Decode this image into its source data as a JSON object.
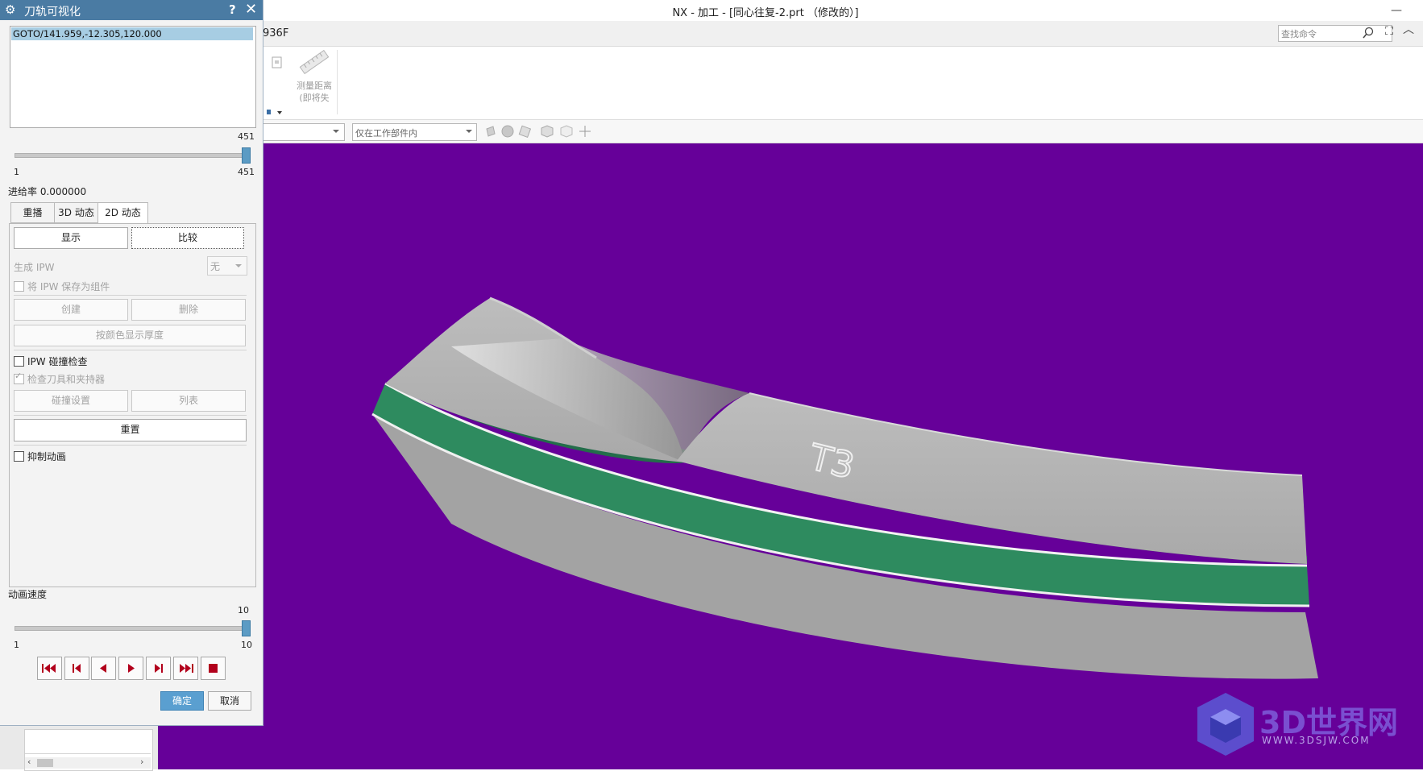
{
  "window": {
    "title": "NX - 加工 - [同心往复-2.prt （修改的）]",
    "partial_label": "936F",
    "search_placeholder": "查找命令",
    "measure_label_1": "测量距离",
    "measure_label_2": "(即将失",
    "filter_value": "仅在工作部件内",
    "minimize": "—",
    "restore": "⛶",
    "collapse": "︿"
  },
  "dialog": {
    "title": "刀轨可视化",
    "help": "?",
    "close": "✕",
    "list_item": "GOTO/141.959,-12.305,120.000",
    "slider1": {
      "value": "451",
      "min": "1",
      "max": "451",
      "fraction": 1.0
    },
    "feed_rate": "进给率 0.000000",
    "tabs": [
      "重播",
      "3D 动态",
      "2D 动态"
    ],
    "active_tab": 2,
    "show_button": "显示",
    "compare_button": "比较",
    "generate_ipw_label": "生成 IPW",
    "generate_ipw_value": "无",
    "save_ipw_label": "将 IPW 保存为组件",
    "create_button": "创建",
    "delete_button": "删除",
    "thickness_button": "按颜色显示厚度",
    "ipw_collision_label": "IPW 碰撞检查",
    "check_tool_label": "检查刀具和夹持器",
    "collision_settings_button": "碰撞设置",
    "list_button": "列表",
    "reset_button": "重置",
    "suppress_anim_label": "抑制动画",
    "anim_speed_label": "动画速度",
    "slider2": {
      "value": "10",
      "min": "1",
      "max": "10",
      "fraction": 1.0
    },
    "ok_button": "确定",
    "cancel_button": "取消"
  },
  "viewport": {
    "part_label": "T3",
    "background": "#660099",
    "part_grey": "#b3b3b3",
    "part_green": "#2e8b5f",
    "watermark_title": "3D世界网",
    "watermark_url": "WWW.3DSJW.COM"
  }
}
